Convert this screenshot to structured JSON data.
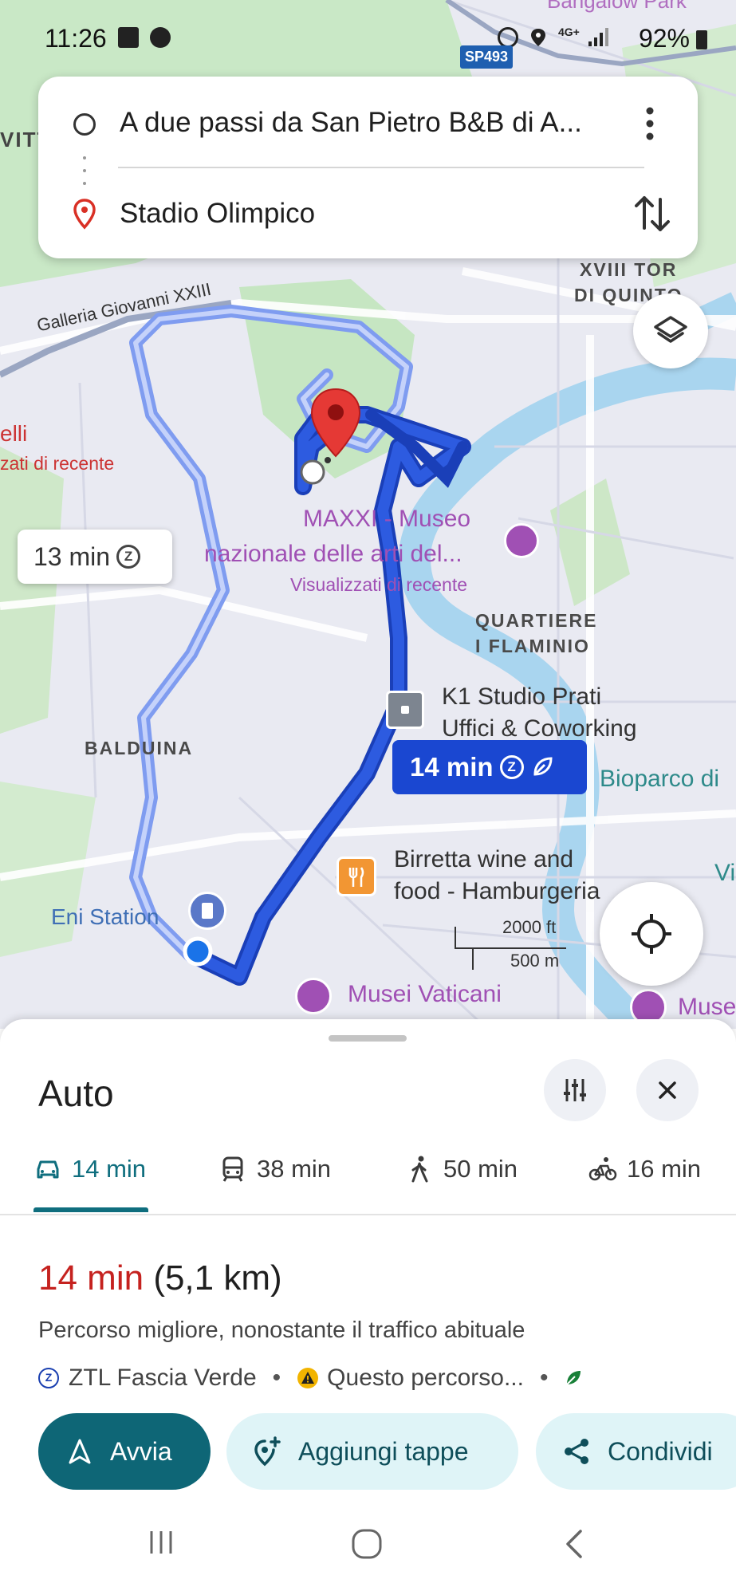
{
  "status_bar": {
    "time": "11:26",
    "battery": "92%",
    "network": "4G+",
    "road_badge": "SP493"
  },
  "search": {
    "origin": "A due passi da San Pietro B&B di A...",
    "destination": "Stadio Olimpico"
  },
  "map": {
    "top_partial": "Bangalow Park",
    "left_partial_top": "VITT",
    "left_partial_1": "elli",
    "left_partial_2": "zati di recente",
    "galleria": "Galleria Giovanni XXIII",
    "district_tor": [
      "XVIII TOR",
      "DI QUINTO"
    ],
    "maxxi_line1": "MAXXI - Museo",
    "maxxi_line2": "nazionale delle arti del...",
    "maxxi_sub": "Visualizzati di recente",
    "district_flaminio": [
      "QUARTIERE",
      "I FLAMINIO"
    ],
    "k1_line1": "K1 Studio Prati",
    "k1_line2": "Uffici & Coworking",
    "bioparco": "Bioparco di",
    "right_partial": "Vi",
    "balduina": "BALDUINA",
    "birretta_line1": "Birretta wine and",
    "birretta_line2": "food - Hamburgeria",
    "eni": "Eni Station",
    "musei_vaticani": "Musei Vaticani",
    "musei_partial": "Muse",
    "scale_ft": "2000 ft",
    "scale_m": "500 m",
    "alt_route_time": "13 min",
    "main_route_time": "14 min",
    "zone_letter": "Z",
    "colors": {
      "route_main": "#1a47d1",
      "route_alt": "#7f9cf0",
      "water": "#a9d5ef",
      "park": "#c9e8c6"
    }
  },
  "sheet": {
    "title": "Auto",
    "modes": [
      {
        "label": "14 min",
        "icon": "car-icon",
        "selected": true
      },
      {
        "label": "38 min",
        "icon": "train-icon",
        "selected": false
      },
      {
        "label": "50 min",
        "icon": "walk-icon",
        "selected": false
      },
      {
        "label": "16 min",
        "icon": "bike-icon",
        "selected": false
      }
    ],
    "duration": "14 min",
    "distance": "(5,1 km)",
    "description": "Percorso migliore, nonostante il traffico abituale",
    "tag_ztl": "ZTL Fascia Verde",
    "tag_warning": "Questo percorso...",
    "bullet": "•",
    "actions": {
      "start": "Avvia",
      "add_stops": "Aggiungi tappe",
      "share": "Condividi"
    }
  }
}
